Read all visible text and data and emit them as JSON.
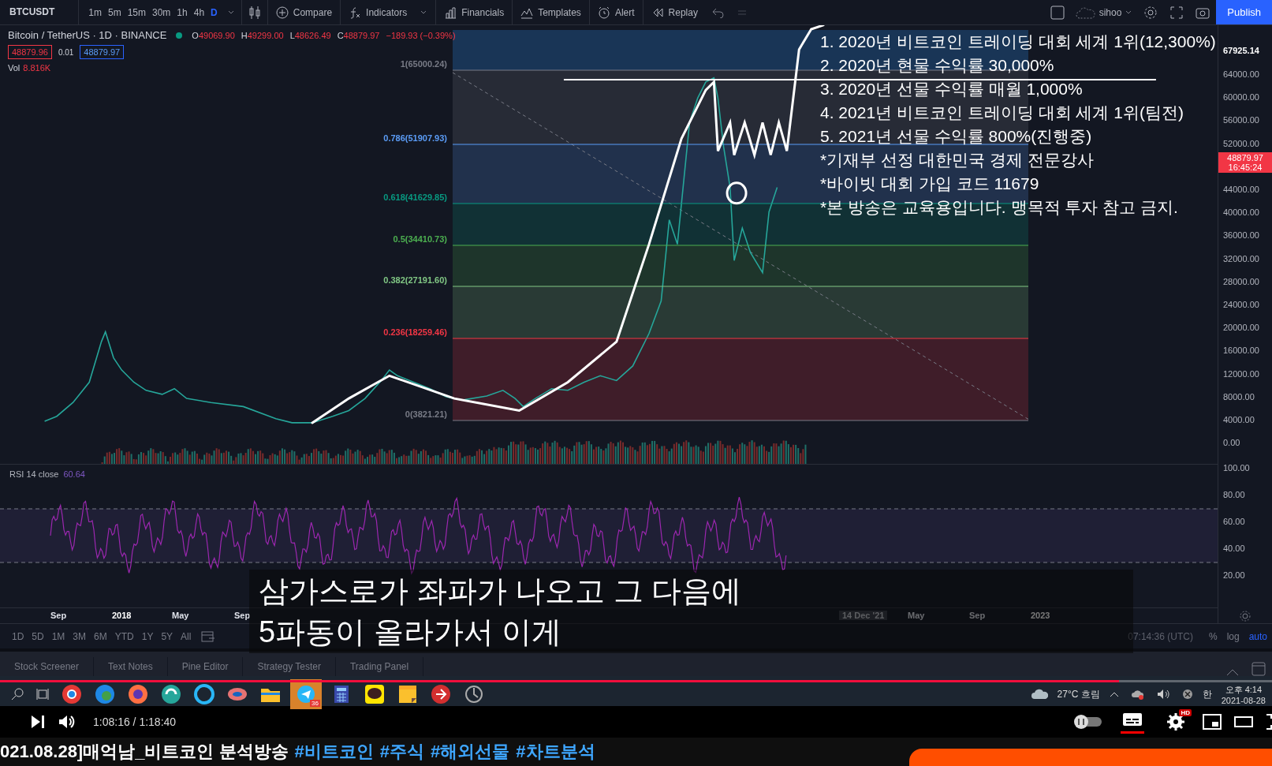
{
  "toolbar": {
    "symbol": "BTCUSDT",
    "intervals": [
      {
        "label": "1m",
        "selected": false
      },
      {
        "label": "5m",
        "selected": false
      },
      {
        "label": "15m",
        "selected": false
      },
      {
        "label": "30m",
        "selected": false
      },
      {
        "label": "1h",
        "selected": false
      },
      {
        "label": "4h",
        "selected": false
      },
      {
        "label": "D",
        "selected": true
      }
    ],
    "tools": [
      {
        "kind": "compare",
        "label": "Compare"
      },
      {
        "kind": "indicators",
        "label": "Indicators"
      },
      {
        "kind": "financials",
        "label": "Financials"
      },
      {
        "kind": "templates",
        "label": "Templates"
      },
      {
        "kind": "alert",
        "label": "Alert"
      },
      {
        "kind": "replay",
        "label": "Replay"
      }
    ],
    "user": "sihoo",
    "publish": "Publish"
  },
  "legend": {
    "title": "Bitcoin / TetherUS · 1D · BINANCE",
    "ohlc": [
      {
        "key": "O",
        "value": "49069.90"
      },
      {
        "key": "H",
        "value": "49299.00"
      },
      {
        "key": "L",
        "value": "48626.49"
      },
      {
        "key": "C",
        "value": "48879.97"
      }
    ],
    "change": "−189.93 (−0.39%)",
    "sell": "48879.96",
    "spread": "0.01",
    "buy": "48879.97",
    "volume_label": "Vol",
    "volume": "8.816K"
  },
  "fib_levels": [
    {
      "label": "1(65000.24)",
      "color": "#787b86"
    },
    {
      "label": "0.786(51907.93)",
      "color": "#5b9cf6"
    },
    {
      "label": "0.618(41629.85)",
      "color": "#089981"
    },
    {
      "label": "0.5(34410.73)",
      "color": "#4caf50"
    },
    {
      "label": "0.382(27191.60)",
      "color": "#81c784"
    },
    {
      "label": "0.236(18259.46)",
      "color": "#f23645"
    },
    {
      "label": "0(3821.21)",
      "color": "#787b86"
    }
  ],
  "price_axis": {
    "high": "67925.14",
    "ticks": [
      "64000.00",
      "60000.00",
      "56000.00",
      "52000.00",
      "44000.00",
      "40000.00",
      "36000.00",
      "32000.00",
      "28000.00",
      "24000.00",
      "20000.00",
      "16000.00",
      "12000.00",
      "8000.00",
      "4000.00",
      "0.00"
    ],
    "last_price": "48879.97",
    "countdown": "16:45:24"
  },
  "rsi": {
    "label": "RSI 14 close",
    "value": "60.64",
    "ticks": [
      "100.00",
      "80.00",
      "60.00",
      "40.00",
      "20.00"
    ]
  },
  "time_axis": [
    {
      "label": "Sep",
      "kind": "tick"
    },
    {
      "label": "2018",
      "kind": "year"
    },
    {
      "label": "May",
      "kind": "tick"
    },
    {
      "label": "Sep",
      "kind": "tick"
    },
    {
      "label": "14 Dec '21",
      "kind": "cursor"
    },
    {
      "label": "May",
      "kind": "tick"
    },
    {
      "label": "Sep",
      "kind": "tick"
    },
    {
      "label": "2023",
      "kind": "year"
    }
  ],
  "ranges": [
    "1D",
    "5D",
    "1M",
    "3M",
    "6M",
    "YTD",
    "1Y",
    "5Y",
    "All"
  ],
  "clock": "07:14:36 (UTC)",
  "scale_modes": [
    {
      "label": "%",
      "selected": false
    },
    {
      "label": "log",
      "selected": false
    },
    {
      "label": "auto",
      "selected": true
    }
  ],
  "bottom_tabs": [
    "Stock Screener",
    "Text Notes",
    "Pine Editor",
    "Strategy Tester",
    "Trading Panel"
  ],
  "annotation_lines": [
    "1. 2020년 비트코인 트레이딩 대회 세계 1위(12,300%)",
    "2. 2020년 현물 수익률 30,000%",
    "3. 2020년 선물 수익률 매월 1,000%",
    "4. 2021년 비트코인 트레이딩 대회 세계 1위(팀전)",
    "5. 2021년 선물 수익률 800%(진행중)",
    "*기재부 선정 대한민국 경제 전문강사",
    "*바이빗 대회 가입 코드 11679",
    "*본 방송은 교육용입니다. 맹목적 투자 참고 금지."
  ],
  "subtitle": [
    "삼가스로가 좌파가 나오고 그 다음에",
    "5파동이 올라가서 이게"
  ],
  "taskbar": {
    "badge": "36",
    "weather": "27°C 흐림",
    "ime": "한",
    "time": "오후 4:14",
    "date": "2021-08-28"
  },
  "player": {
    "time": "1:08:16 / 1:18:40",
    "progress": {
      "level": 0.88
    },
    "captions_on": true,
    "quality_badge": "HD"
  },
  "video_title": {
    "text": "021.08.28]매억남_비트코인 분석방송",
    "hashtags": [
      "#비트코인",
      "#주식",
      "#해외선물",
      "#차트분석"
    ]
  }
}
